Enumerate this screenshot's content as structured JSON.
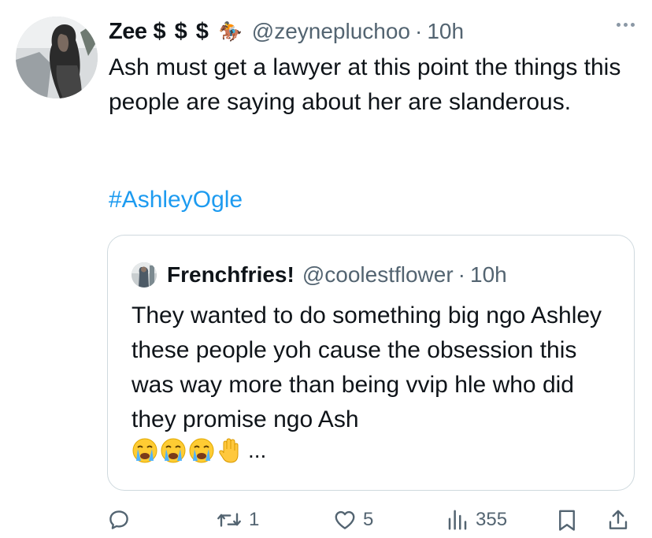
{
  "tweet": {
    "author_name": "Zee",
    "dollar_badges": "$$$",
    "horse_emoji": "🏇",
    "handle": "@zeynepluchoo",
    "separator": "·",
    "time": "10h",
    "text": "Ash must get a lawyer at this point the things this people are saying about her are slanderous.",
    "hashtag": "#AshleyOgle"
  },
  "quote": {
    "author_name": "Frenchfries!",
    "handle": "@coolestflower",
    "separator": "·",
    "time": "10h",
    "text": "They wanted to do something big ngo Ashley these people yoh cause the obsession this was way more than being vvip hle who did they promise ngo Ash",
    "ellipsis": "..."
  },
  "actions": {
    "reply_count": "",
    "retweet_count": "1",
    "like_count": "5",
    "views_count": "355"
  },
  "colors": {
    "link": "#1d9bf0",
    "secondary_text": "#536471",
    "border": "#cfd9de"
  }
}
